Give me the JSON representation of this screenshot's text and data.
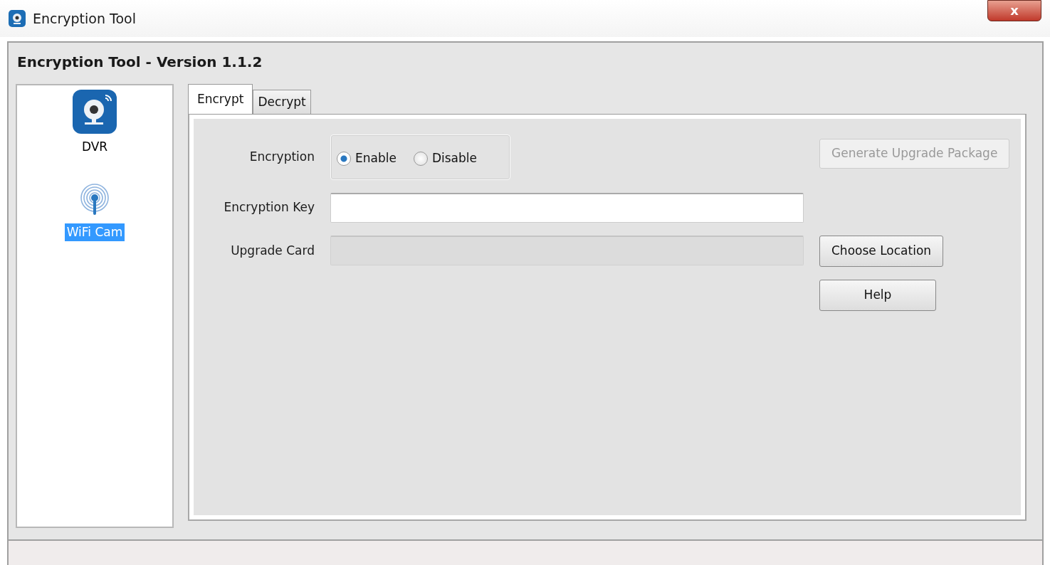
{
  "window": {
    "title": "Encryption Tool",
    "close": "x"
  },
  "header": "Encryption Tool - Version 1.1.2",
  "sidebar": {
    "items": [
      {
        "label": "DVR",
        "kind": "webcam",
        "selected": false
      },
      {
        "label": "WiFi Cam",
        "kind": "antenna",
        "selected": true
      }
    ]
  },
  "tabs": [
    {
      "label": "Encrypt",
      "selected": true
    },
    {
      "label": "Decrypt",
      "selected": false
    }
  ],
  "encryption": {
    "label": "Encryption",
    "options": [
      {
        "label": "Enable",
        "selected": true
      },
      {
        "label": "Disable",
        "selected": false
      }
    ]
  },
  "fields": [
    {
      "label": "Encryption Key",
      "disabled": false
    },
    {
      "label": "Upgrade Card",
      "disabled": true
    }
  ],
  "buttons": [
    {
      "label": "Generate Upgrade Package",
      "disabled": true
    },
    {
      "label": "Choose Location",
      "disabled": false
    },
    {
      "label": "Help",
      "disabled": false
    }
  ]
}
